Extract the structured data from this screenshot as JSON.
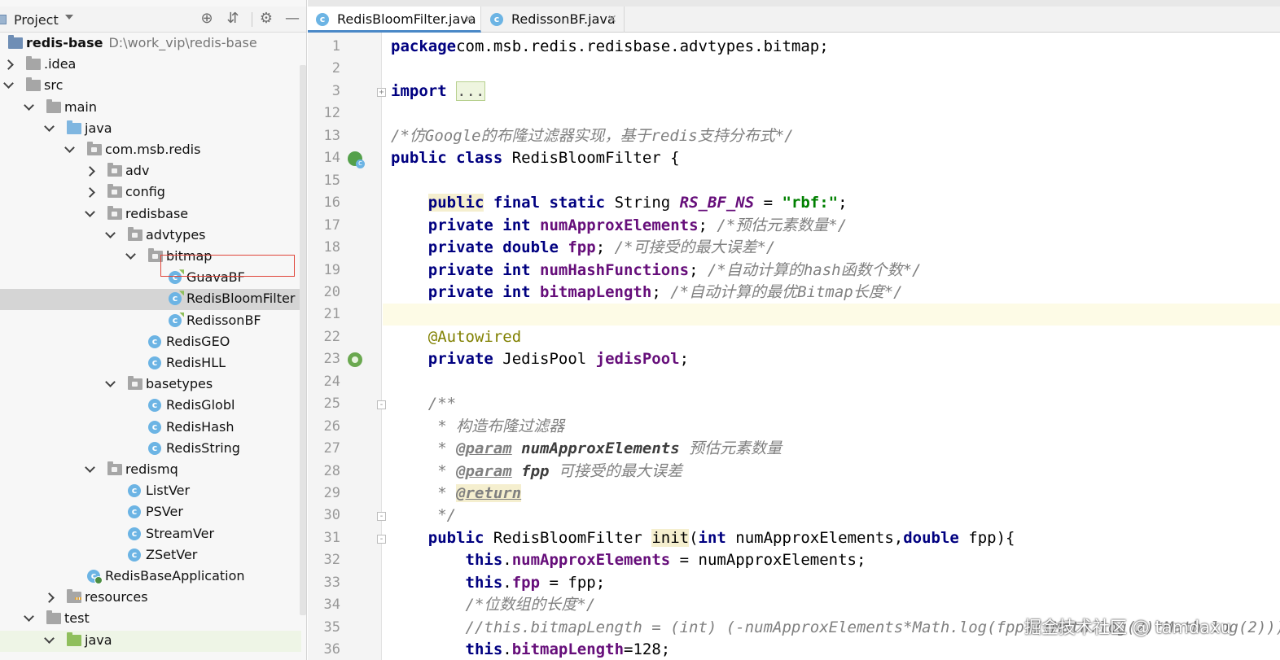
{
  "project_panel": {
    "title": "Project",
    "tree": [
      {
        "label": "redis-base",
        "path": "D:\\work_vip\\redis-base",
        "type": "module"
      },
      {
        "label": ".idea",
        "type": "folder"
      },
      {
        "label": "src",
        "type": "folder"
      },
      {
        "label": "main",
        "type": "folder"
      },
      {
        "label": "java",
        "type": "source-folder"
      },
      {
        "label": "com.msb.redis",
        "type": "package"
      },
      {
        "label": "adv",
        "type": "package"
      },
      {
        "label": "config",
        "type": "package"
      },
      {
        "label": "redisbase",
        "type": "package"
      },
      {
        "label": "advtypes",
        "type": "package"
      },
      {
        "label": "bitmap",
        "type": "package"
      },
      {
        "label": "GuavaBF",
        "type": "class"
      },
      {
        "label": "RedisBloomFilter",
        "type": "class",
        "selected": true
      },
      {
        "label": "RedissonBF",
        "type": "class"
      },
      {
        "label": "RedisGEO",
        "type": "class"
      },
      {
        "label": "RedisHLL",
        "type": "class"
      },
      {
        "label": "basetypes",
        "type": "package"
      },
      {
        "label": "RedisGlobl",
        "type": "class"
      },
      {
        "label": "RedisHash",
        "type": "class"
      },
      {
        "label": "RedisString",
        "type": "class"
      },
      {
        "label": "redismq",
        "type": "package"
      },
      {
        "label": "ListVer",
        "type": "class"
      },
      {
        "label": "PSVer",
        "type": "class"
      },
      {
        "label": "StreamVer",
        "type": "class"
      },
      {
        "label": "ZSetVer",
        "type": "class"
      },
      {
        "label": "RedisBaseApplication",
        "type": "app-class"
      },
      {
        "label": "resources",
        "type": "resources-folder"
      },
      {
        "label": "test",
        "type": "folder"
      },
      {
        "label": "java",
        "type": "test-folder"
      }
    ]
  },
  "tabs": [
    {
      "label": "RedisBloomFilter.java",
      "active": true
    },
    {
      "label": "RedissonBF.java",
      "active": false
    }
  ],
  "editor": {
    "line_numbers": [
      "1",
      "2",
      "3",
      "12",
      "13",
      "14",
      "15",
      "16",
      "17",
      "18",
      "19",
      "20",
      "21",
      "22",
      "23",
      "24",
      "25",
      "26",
      "27",
      "28",
      "29",
      "30",
      "31",
      "32",
      "33",
      "34",
      "35",
      "36"
    ],
    "lines": [
      {
        "p": [
          [
            "kw",
            "package"
          ],
          [
            "",
            "com.msb.redis.redisbase.advtypes.bitmap;"
          ]
        ]
      },
      {
        "p": []
      },
      {
        "p": [
          [
            "kw",
            "import "
          ],
          [
            "fold-ph",
            "..."
          ]
        ]
      },
      {
        "p": []
      },
      {
        "p": [
          [
            "cmt",
            "/*仿Google的布隆过滤器实现，基于redis支持分布式*/"
          ]
        ]
      },
      {
        "p": [
          [
            "kw",
            "public class "
          ],
          [
            "",
            "RedisBloomFilter {"
          ]
        ]
      },
      {
        "p": []
      },
      {
        "p": [
          [
            "",
            "    "
          ],
          [
            "kw hl",
            "public"
          ],
          [
            "kw",
            " final static "
          ],
          [
            "",
            "String "
          ],
          [
            "sfld",
            "RS_BF_NS"
          ],
          [
            "",
            " = "
          ],
          [
            "str",
            "\"rbf:\""
          ],
          [
            "",
            ";"
          ]
        ]
      },
      {
        "p": [
          [
            "",
            "    "
          ],
          [
            "kw",
            "private int "
          ],
          [
            "fld",
            "numApproxElements"
          ],
          [
            "",
            "; "
          ],
          [
            "cmt",
            "/*预估元素数量*/"
          ]
        ]
      },
      {
        "p": [
          [
            "",
            "    "
          ],
          [
            "kw",
            "private double "
          ],
          [
            "fld",
            "fpp"
          ],
          [
            "",
            "; "
          ],
          [
            "cmt",
            "/*可接受的最大误差*/"
          ]
        ]
      },
      {
        "p": [
          [
            "",
            "    "
          ],
          [
            "kw",
            "private int "
          ],
          [
            "fld",
            "numHashFunctions"
          ],
          [
            "",
            "; "
          ],
          [
            "cmt",
            "/*自动计算的hash函数个数*/"
          ]
        ]
      },
      {
        "p": [
          [
            "",
            "    "
          ],
          [
            "kw",
            "private int "
          ],
          [
            "fld",
            "bitmapLength"
          ],
          [
            "",
            "; "
          ],
          [
            "cmt",
            "/*自动计算的最优Bitmap长度*/"
          ]
        ]
      },
      {
        "p": [],
        "current": true
      },
      {
        "p": [
          [
            "",
            "    "
          ],
          [
            "anno",
            "@Autowired"
          ]
        ]
      },
      {
        "p": [
          [
            "",
            "    "
          ],
          [
            "kw",
            "private "
          ],
          [
            "",
            "JedisPool "
          ],
          [
            "fld",
            "jedisPool"
          ],
          [
            "",
            ";"
          ]
        ]
      },
      {
        "p": []
      },
      {
        "p": [
          [
            "",
            "    "
          ],
          [
            "doc",
            "/**"
          ]
        ]
      },
      {
        "p": [
          [
            "",
            "     "
          ],
          [
            "doc",
            "* 构造布隆过滤器"
          ]
        ]
      },
      {
        "p": [
          [
            "",
            "     "
          ],
          [
            "doc",
            "* "
          ],
          [
            "doctag",
            "@param"
          ],
          [
            "",
            ""
          ],
          [
            "docparam",
            " numApproxElements"
          ],
          [
            "doc",
            " 预估元素数量"
          ]
        ]
      },
      {
        "p": [
          [
            "",
            "     "
          ],
          [
            "doc",
            "* "
          ],
          [
            "doctag",
            "@param"
          ],
          [
            "docparam",
            " fpp"
          ],
          [
            "doc",
            " 可接受的最大误差"
          ]
        ]
      },
      {
        "p": [
          [
            "",
            "     "
          ],
          [
            "doc",
            "* "
          ],
          [
            "doctag ret",
            "@return"
          ]
        ]
      },
      {
        "p": [
          [
            "",
            "     "
          ],
          [
            "doc",
            "*/"
          ]
        ]
      },
      {
        "p": [
          [
            "",
            "    "
          ],
          [
            "kw",
            "public "
          ],
          [
            "",
            "RedisBloomFilter "
          ],
          [
            "hl",
            "init"
          ],
          [
            "",
            "("
          ],
          [
            "kw",
            "int "
          ],
          [
            "",
            "numApproxElements,"
          ],
          [
            "kw",
            "double "
          ],
          [
            "",
            "fpp){"
          ]
        ]
      },
      {
        "p": [
          [
            "",
            "        "
          ],
          [
            "kw",
            "this"
          ],
          [
            "",
            "."
          ],
          [
            "fld",
            "numApproxElements"
          ],
          [
            "",
            " = numApproxElements;"
          ]
        ]
      },
      {
        "p": [
          [
            "",
            "        "
          ],
          [
            "kw",
            "this"
          ],
          [
            "",
            "."
          ],
          [
            "fld",
            "fpp"
          ],
          [
            "",
            " = fpp;"
          ]
        ]
      },
      {
        "p": [
          [
            "",
            "        "
          ],
          [
            "cmt",
            "/*位数组的长度*/"
          ]
        ]
      },
      {
        "p": [
          [
            "",
            "        "
          ],
          [
            "cmt",
            "//this.bitmapLength = (int) (-numApproxElements*Math.log(fpp)/(Math.log(2)*Math.log(2)));"
          ]
        ]
      },
      {
        "p": [
          [
            "",
            "        "
          ],
          [
            "kw",
            "this"
          ],
          [
            "",
            "."
          ],
          [
            "fld",
            "bitmapLength"
          ],
          [
            "",
            "=128;"
          ]
        ]
      }
    ]
  },
  "watermark": "掘金技术社区 @ tamdaxu"
}
